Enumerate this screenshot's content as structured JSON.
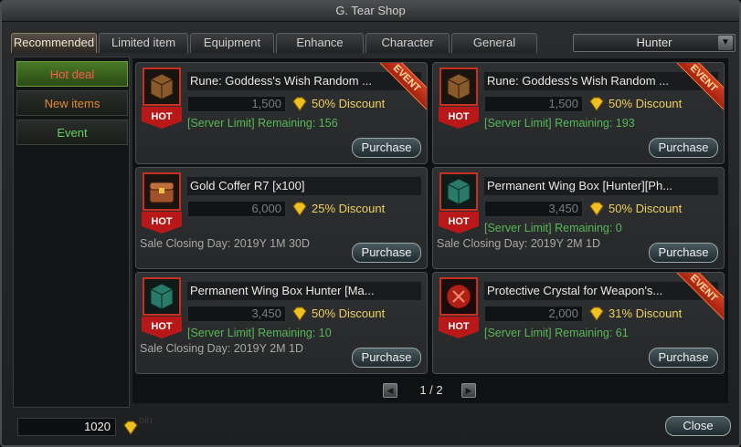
{
  "window": {
    "title": "G. Tear Shop"
  },
  "tabs": [
    {
      "label": "Recommended",
      "active": true
    },
    {
      "label": "Limited item",
      "active": false
    },
    {
      "label": "Equipment",
      "active": false
    },
    {
      "label": "Enhance",
      "active": false
    },
    {
      "label": "Character",
      "active": false
    },
    {
      "label": "General",
      "active": false
    }
  ],
  "class_select": {
    "value": "Hunter"
  },
  "sidebar": {
    "items": [
      {
        "label": "Hot deal",
        "active": true
      },
      {
        "label": "New items",
        "active": false
      },
      {
        "label": "Event",
        "active": false
      }
    ]
  },
  "products": [
    {
      "name": "Rune: Goddess's Wish Random ...",
      "price": "1,500",
      "discount": "50% Discount",
      "limit": "[Server Limit] Remaining: 156",
      "closing": "",
      "badge": "HOT",
      "event": "EVENT",
      "icon": "chest-brown-icon",
      "button": "Purchase"
    },
    {
      "name": "Rune: Goddess's Wish Random ...",
      "price": "1,500",
      "discount": "50% Discount",
      "limit": "[Server Limit] Remaining: 193",
      "closing": "",
      "badge": "HOT",
      "event": "EVENT",
      "icon": "chest-brown-icon",
      "button": "Purchase"
    },
    {
      "name": "Gold Coffer R7 [x100]",
      "price": "6,000",
      "discount": "25% Discount",
      "limit": "",
      "closing": "Sale Closing Day: 2019Y 1M 30D",
      "badge": "HOT",
      "event": "",
      "icon": "gold-coffer-icon",
      "button": "Purchase"
    },
    {
      "name": "Permanent Wing Box [Hunter][Ph...",
      "price": "3,450",
      "discount": "50% Discount",
      "limit": "[Server Limit] Remaining: 0",
      "closing": "Sale Closing Day: 2019Y 2M 1D",
      "badge": "HOT",
      "event": "",
      "icon": "chest-teal-icon",
      "button": "Purchase"
    },
    {
      "name": "Permanent Wing Box Hunter [Ma...",
      "price": "3,450",
      "discount": "50% Discount",
      "limit": "[Server Limit] Remaining: 10",
      "closing": "Sale Closing Day: 2019Y 2M 1D",
      "badge": "HOT",
      "event": "",
      "icon": "chest-teal-icon",
      "button": "Purchase"
    },
    {
      "name": "Protective Crystal for Weapon's...",
      "price": "2,000",
      "discount": "31% Discount",
      "limit": "[Server Limit] Remaining: 61",
      "closing": "",
      "badge": "HOT",
      "event": "EVENT",
      "icon": "red-crystal-icon",
      "button": "Purchase"
    }
  ],
  "pager": {
    "text": "1 / 2",
    "prev": "◀",
    "next": "▶"
  },
  "footer": {
    "balance": "1020",
    "coin_label": "oin",
    "close_label": "Close"
  },
  "colors": {
    "accent_green": "#58b858",
    "discount_gold": "#f0d060",
    "hot_red": "#c81818",
    "event_red": "#d84020"
  }
}
